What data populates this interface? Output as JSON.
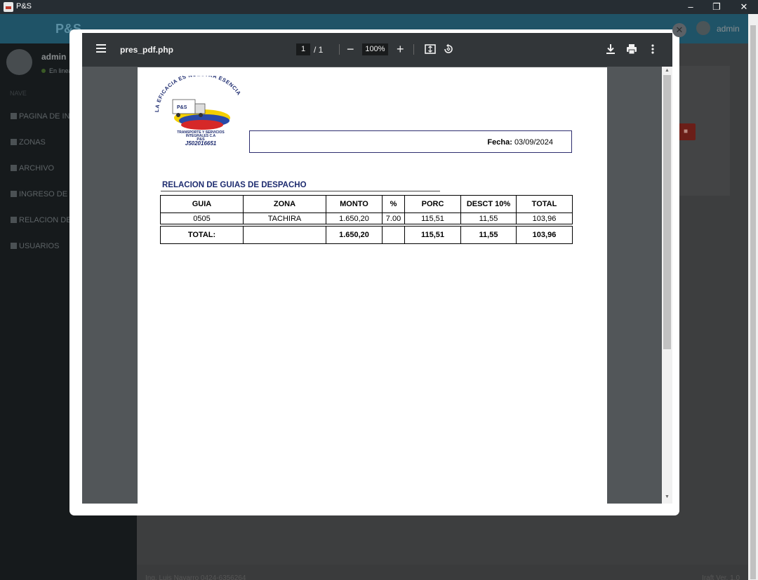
{
  "window": {
    "title": "P&S",
    "minimize_glyph": "–",
    "restore_glyph": "❐",
    "close_glyph": "✕"
  },
  "app": {
    "brand": "P&S",
    "user": "admin",
    "user_status": "En linea",
    "nav_header": "NAVE",
    "menu": [
      {
        "label": "PAGINA DE INICIO",
        "icon": "dashboard-icon"
      },
      {
        "label": "ZONAS",
        "icon": "map-marker-icon"
      },
      {
        "label": "ARCHIVO",
        "icon": "folder-icon"
      },
      {
        "label": "INGRESO DE GUIAS",
        "icon": "file-icon"
      },
      {
        "label": "RELACION DE GUIAS",
        "icon": "file-text-icon"
      },
      {
        "label": "USUARIOS",
        "icon": "users-icon"
      }
    ],
    "footer_left": "Ing. Luis Navarro 0424-6356264",
    "footer_right": "Iraft Ver. 1.0"
  },
  "pdf_viewer": {
    "filename": "pres_pdf.php",
    "current_page": "1",
    "page_total": "/ 1",
    "zoom": "100%"
  },
  "document": {
    "logo_arc_text": "LA EFICACIA ES NUESTRA ESENCIA",
    "logo_line1": "TRANSPORTE Y SERVICIOS",
    "logo_line2": "INTEGRALES C.A",
    "logo_brand": "P&S",
    "logo_rif": "J502016651",
    "truck_label": "P&S",
    "fecha_label": "Fecha:",
    "fecha_value": "03/09/2024",
    "report_title": "RELACION DE GUIAS DE DESPACHO",
    "columns": [
      "GUIA",
      "ZONA",
      "MONTO",
      "%",
      "PORC",
      "DESCT 10%",
      "TOTAL"
    ],
    "rows": [
      [
        "0505",
        "TACHIRA",
        "1.650,20",
        "7.00",
        "115,51",
        "11,55",
        "103,96"
      ]
    ],
    "totals": [
      "TOTAL:",
      "",
      "1.650,20",
      "",
      "115,51",
      "11,55",
      "103,96"
    ]
  },
  "colors": {
    "report_title": "#1d2b6f",
    "viewer_toolbar": "#323639",
    "viewer_bg": "#525659"
  }
}
